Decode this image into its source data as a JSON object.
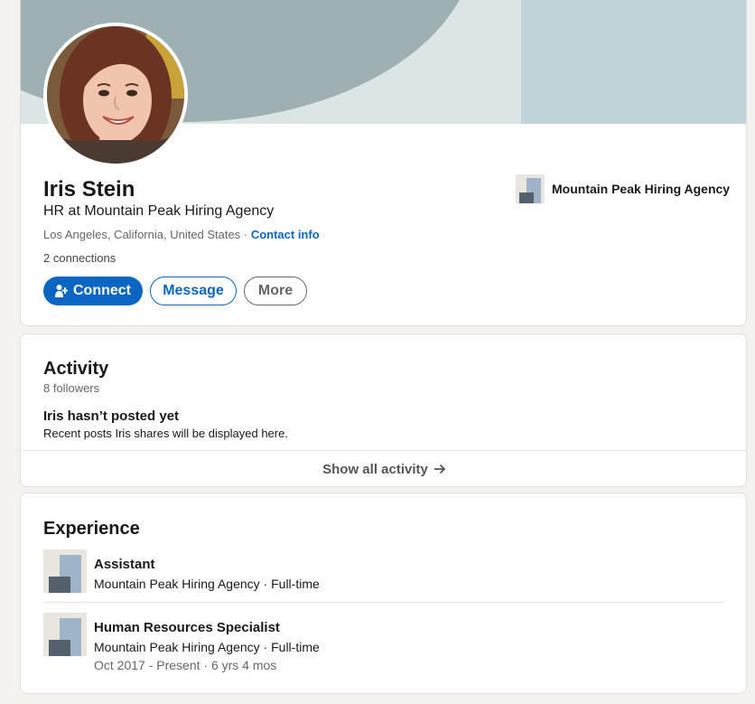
{
  "profile": {
    "name": "Iris Stein",
    "headline": "HR at Mountain Peak Hiring Agency",
    "location": "Los Angeles, California, United States",
    "separator": " · ",
    "contact_info_label": "Contact info",
    "connections": "2 connections",
    "current_company": "Mountain Peak Hiring Agency"
  },
  "actions": {
    "connect_label": "Connect",
    "message_label": "Message",
    "more_label": "More"
  },
  "activity": {
    "title": "Activity",
    "followers": "8 followers",
    "empty_title": "Iris hasn’t posted yet",
    "empty_subtitle": "Recent posts Iris shares will be displayed here.",
    "show_all_label": "Show all activity"
  },
  "experience": {
    "title": "Experience",
    "items": [
      {
        "title": "Assistant",
        "company_line": "Mountain Peak Hiring Agency · Full-time",
        "dates": ""
      },
      {
        "title": "Human Resources Specialist",
        "company_line": "Mountain Peak Hiring Agency · Full-time",
        "dates": "Oct 2017 - Present · 6 yrs 4 mos"
      }
    ]
  },
  "colors": {
    "brand_blue": "#0a66c2",
    "page_background": "#f3f2ef",
    "banner_dark": "#9fb0b3",
    "banner_light": "#bfd3d8"
  },
  "icons": {
    "connect": "add-person-icon",
    "show_all": "arrow-right-icon",
    "company_logo": "company-logo-icon"
  }
}
